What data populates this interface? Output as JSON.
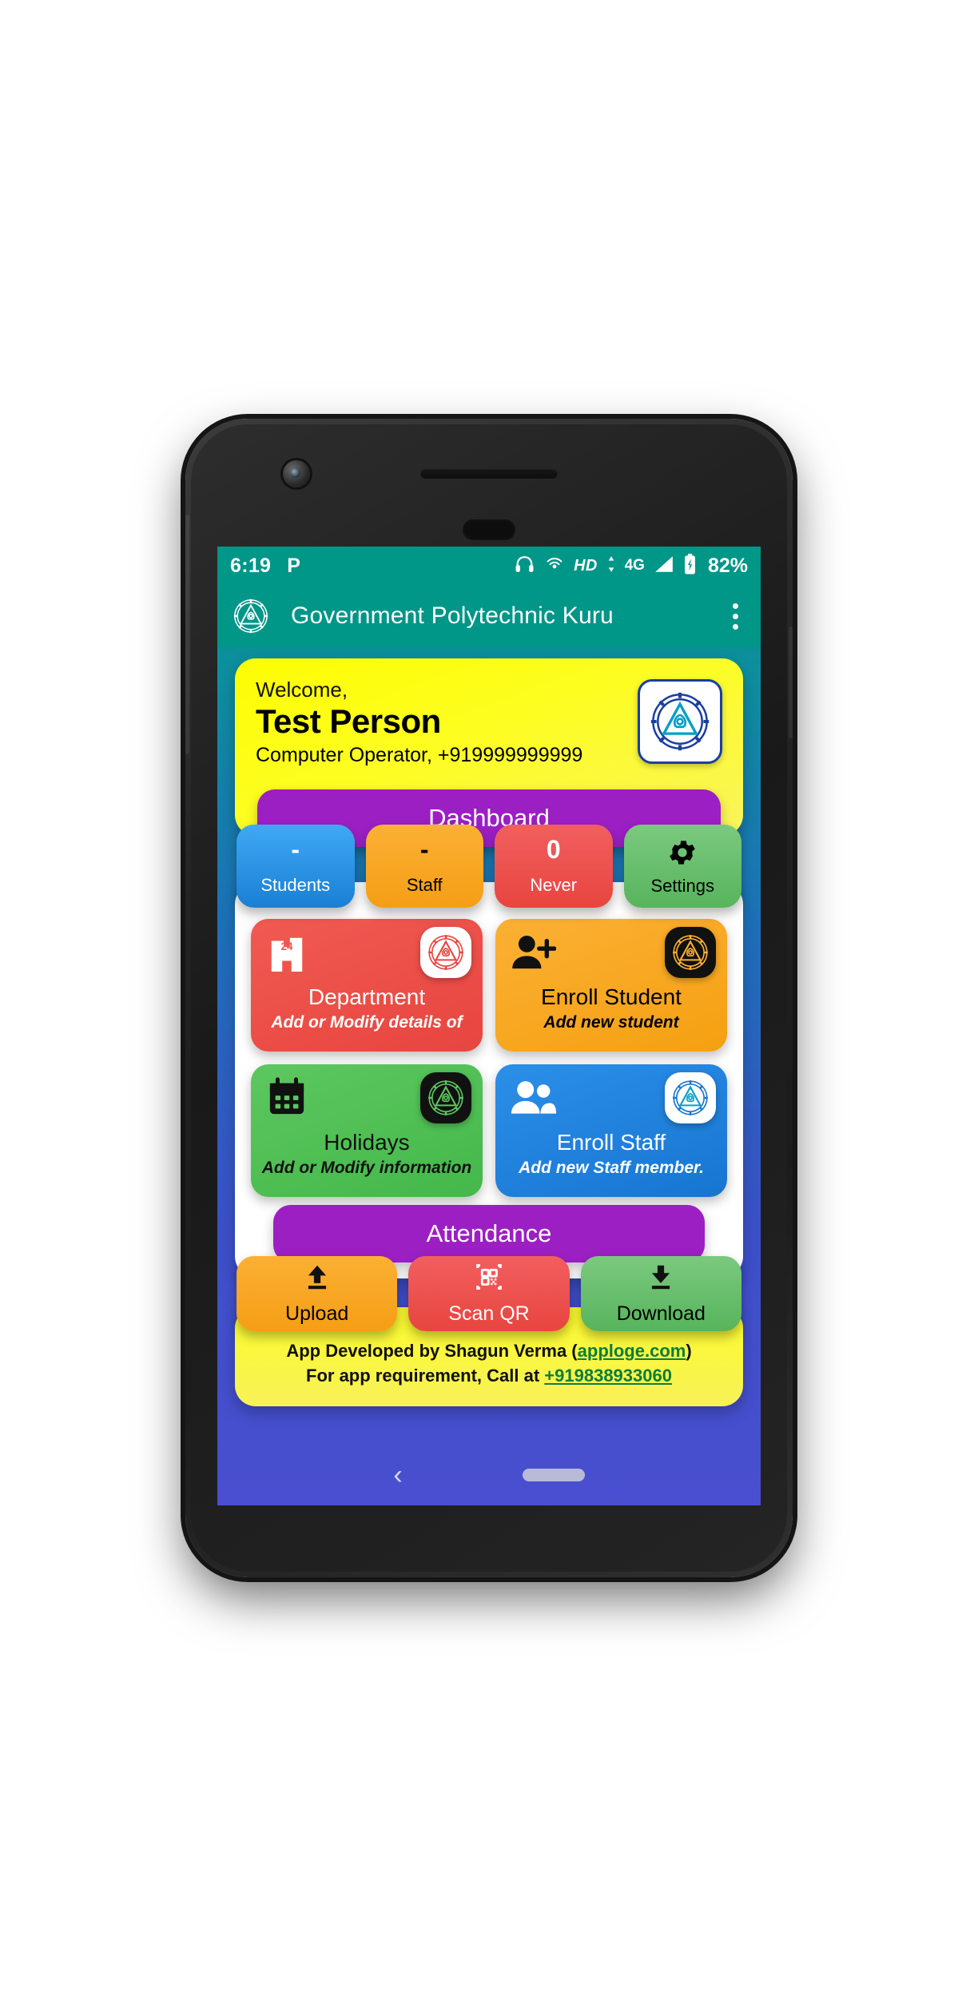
{
  "status_bar": {
    "time": "6:19",
    "carrier_icon_label": "P",
    "icons": [
      "headphones-icon",
      "cast-icon"
    ],
    "network_hd": "HD",
    "network_type": "4G",
    "battery_percent": "82%"
  },
  "app_bar": {
    "logo": "college-emblem-icon",
    "title": "Government Polytechnic Kuru",
    "overflow": "overflow-menu-icon"
  },
  "welcome": {
    "greeting": "Welcome,",
    "name": "Test Person",
    "role_and_phone": "Computer Operator,  +919999999999",
    "logo_alt": "college-emblem"
  },
  "dashboard": {
    "title": "Dashboard",
    "stats": [
      {
        "value": "-",
        "label": "Students",
        "color": "#2196f3",
        "text_color": "#ffffff"
      },
      {
        "value": "-",
        "label": "Staff",
        "color": "#f9a825",
        "text_color": "#000000"
      },
      {
        "value": "0",
        "label": "Never",
        "color": "#ef5350",
        "text_color": "#ffffff"
      },
      {
        "value": "gear-icon",
        "label": "Settings",
        "color": "#66bb6a",
        "text_color": "#000000"
      }
    ]
  },
  "menu_cards": [
    {
      "title": "Department",
      "subtitle": "Add or Modify details of",
      "color": "#ef5350",
      "text_color": "#ffffff",
      "icon": "building-24-icon",
      "badge": "college-emblem-badge",
      "badge_bg": "#ffffff"
    },
    {
      "title": "Enroll Student",
      "subtitle": "Add new student",
      "color": "#f9a825",
      "text_color": "#000000",
      "icon": "person-add-icon",
      "badge": "college-emblem-badge",
      "badge_bg": "#000000"
    },
    {
      "title": "Holidays",
      "subtitle": "Add or Modify information",
      "color": "#4caf50",
      "text_color": "#000000",
      "icon": "calendar-icon",
      "badge": "college-emblem-badge",
      "badge_bg": "#000000"
    },
    {
      "title": "Enroll Staff",
      "subtitle": "Add new Staff member.",
      "color": "#1e88e5",
      "text_color": "#ffffff",
      "icon": "people-icon",
      "badge": "college-emblem-badge",
      "badge_bg": "#ffffff"
    }
  ],
  "attendance": {
    "title": "Attendance",
    "actions": [
      {
        "label": "Upload",
        "color": "#f9a825",
        "text_color": "#000000",
        "icon": "upload-icon"
      },
      {
        "label": "Scan QR",
        "color": "#ef5350",
        "text_color": "#ffffff",
        "icon": "qr-code-icon"
      },
      {
        "label": "Download",
        "color": "#66bb6a",
        "text_color": "#000000",
        "icon": "download-icon"
      }
    ]
  },
  "footer": {
    "line1_prefix": "App Developed by Shagun Verma (",
    "line1_link": "apploge.com",
    "line1_suffix": ")",
    "line2_prefix": "For app requirement, Call at ",
    "line2_link": "+919838933060"
  },
  "nav_bar": {
    "back": "back-chevron-icon",
    "home": "home-pill-icon"
  },
  "theme": {
    "primary": "#009688",
    "accent_yellow": "#fdfd03",
    "purple": "#9c1fc4",
    "link_green": "#0a7d3d"
  }
}
